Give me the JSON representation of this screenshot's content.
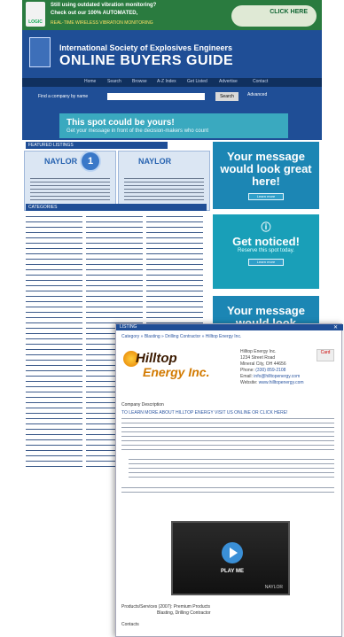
{
  "top_ad": {
    "logo": "LOGIC",
    "line1": "Still using outdated vibration monitoring?",
    "line2": "Check out our 100% AUTOMATED,",
    "line3": "REAL-TIME WIRELESS VIBRATION MONITORING",
    "cta": "CLICK HERE"
  },
  "header": {
    "org": "International Society of Explosives Engineers",
    "title": "ONLINE BUYERS GUIDE"
  },
  "nav": [
    "Home",
    "Search",
    "Browse",
    "A-Z Index",
    "Get Listed",
    "Advertise",
    "Contact"
  ],
  "search": {
    "label": "Find a company by name",
    "button": "Search",
    "advanced": "Advanced"
  },
  "spot_ad": {
    "title": "This spot could be yours!",
    "subtitle": "Get your message in front of the decision-makers who count"
  },
  "featured": {
    "header": "FEATURED LISTINGS",
    "brand1": "NAYLOR",
    "brand2": "NAYLOR",
    "badge": "1"
  },
  "categories": {
    "header": "CATEGORIES"
  },
  "side_ads": [
    {
      "main": "Your message would look great here!",
      "pill": "Learn more"
    },
    {
      "main": "Get noticed!",
      "sub": "Reserve this spot today.",
      "pill": "Learn more"
    },
    {
      "main": "Your message would look",
      "pill": ""
    }
  ],
  "listing": {
    "bar": "LISTING",
    "close": "✕",
    "breadcrumb": "Category » Blasting » Drilling Contractor » Hilltop Energy Inc.",
    "logo_line1": "Hilltop",
    "logo_line2": "Energy Inc.",
    "company": "Hilltop Energy Inc.",
    "address1": "1234 Street Road",
    "address2": "Mineral City, OH 44656",
    "phone_label": "Phone:",
    "phone": "(330) 859-2108",
    "email_label": "Email:",
    "email": "info@hilltopenergy.com",
    "site_label": "Website:",
    "site": "www.hilltopenergy.com",
    "tag": "Card",
    "description_label": "Company Description",
    "learn_more": "TO LEARN MORE ABOUT HILLTOP ENERGY VISIT US ONLINE OR CLICK HERE!",
    "video_label": "PLAY ME",
    "video_brand": "NAYLOR",
    "products_label": "Products/Services (2007): Premium Products",
    "products_1": "Blasting, Drilling Contractor",
    "contacts": "Contacts"
  }
}
